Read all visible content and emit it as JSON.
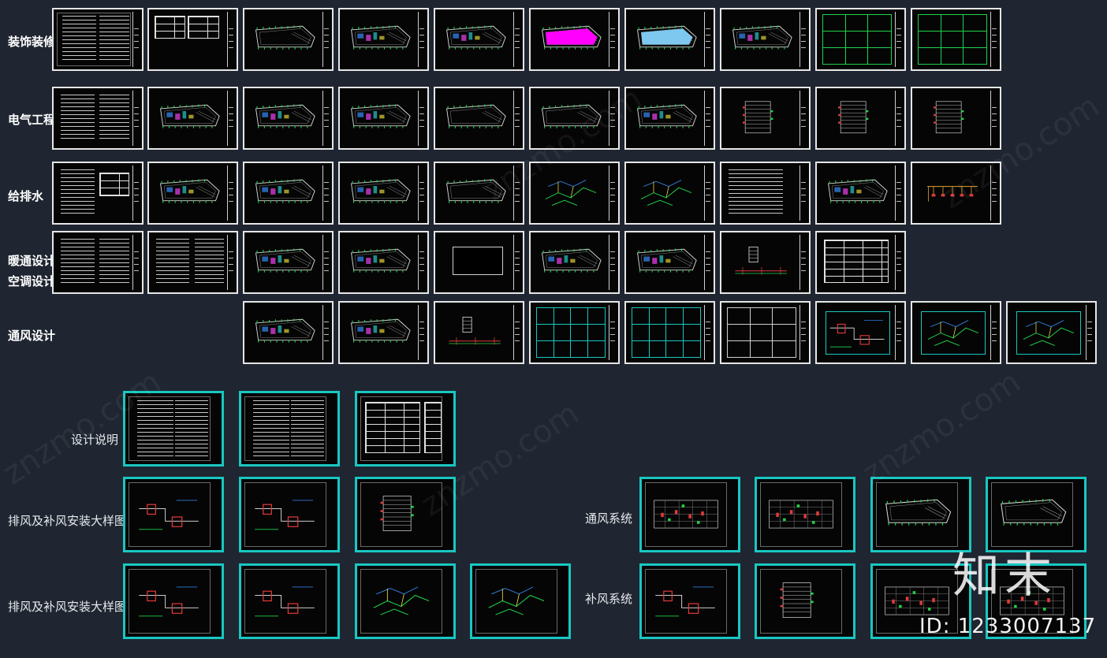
{
  "rows": {
    "decoration": "装饰装修",
    "electrical": "电气工程",
    "plumbing": "给排水",
    "hvac_1": "暖通设计",
    "hvac_2": "空调设计",
    "ventilation": "通风设计"
  },
  "details": {
    "design_notes": "设计说明",
    "install_detail_1": "排风及补风安装大样图",
    "install_detail_2": "排风及补风安装大样图",
    "ventilation_system": "通风系统",
    "makeup_system": "补风系统"
  },
  "watermark": {
    "text": "znzmo.com",
    "logo": "知末",
    "id": "ID: 1233007137"
  },
  "colors": {
    "background": "#1f2631",
    "sheet_border": "#e6e6e6",
    "accent_cyan": "#19c7c2",
    "cad_green": "#1fd34a",
    "magenta": "#ff00ff",
    "light_blue": "#7ec8f0"
  }
}
